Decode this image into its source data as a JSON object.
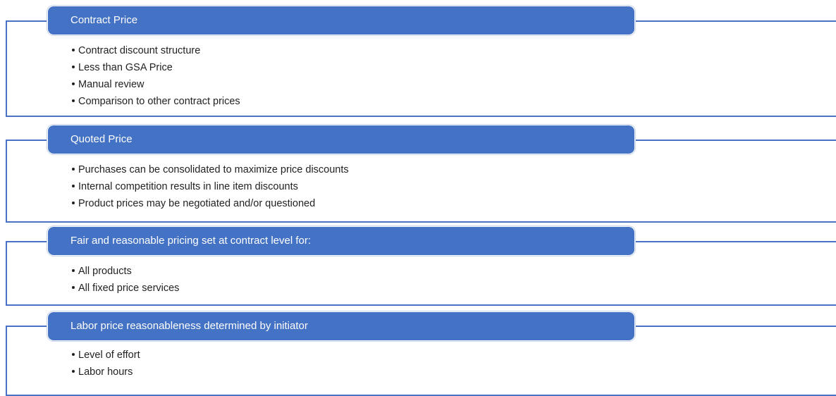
{
  "colors": {
    "header_fill": "#4472c4",
    "frame_line": "#4a72c4",
    "header_text": "#ffffff",
    "bullet_text": "#222222"
  },
  "sections": [
    {
      "title": "Contract Price",
      "items": [
        "Contract discount structure",
        "Less than GSA Price",
        "Manual review",
        "Comparison to other contract prices"
      ]
    },
    {
      "title": "Quoted Price",
      "items": [
        "Purchases can be consolidated to maximize price discounts",
        "Internal competition results in line item discounts",
        "Product prices may be negotiated and/or questioned"
      ]
    },
    {
      "title": "Fair and reasonable pricing set at contract level for:",
      "items": [
        "All products",
        "All fixed price services"
      ]
    },
    {
      "title": "Labor price reasonableness determined by initiator",
      "items": [
        "Level of effort",
        "Labor hours"
      ]
    }
  ]
}
